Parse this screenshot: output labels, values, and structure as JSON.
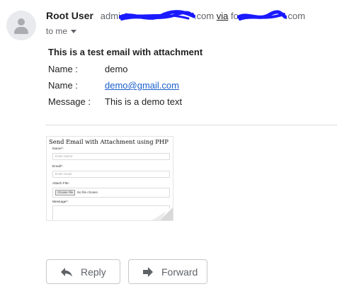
{
  "header": {
    "sender_name": "Root User",
    "sender_addr_start": "admi",
    "sender_addr_end": ".com",
    "via_label": "via",
    "via_addr_start": "fo",
    "via_addr_end": ".com",
    "recipient_label": "to me"
  },
  "message": {
    "title": "This is a test email with attachment",
    "fields": [
      {
        "label": "Name :",
        "value": "demo"
      },
      {
        "label": "Name :",
        "value": "demo@gmail.com"
      },
      {
        "label": "Message :",
        "value": "This is a demo text"
      }
    ]
  },
  "attachment_preview": {
    "title": "Send Email with Attachment using PHP",
    "name_label": "Name*:",
    "name_placeholder": "Enter Name",
    "email_label": "Email*:",
    "email_placeholder": "Enter email",
    "file_label": "Attach File:",
    "choose_file": "Choose File",
    "no_file": "No file chosen",
    "message_label": "Message*:"
  },
  "actions": {
    "reply": "Reply",
    "forward": "Forward"
  },
  "colors": {
    "redaction": "#1a1aff",
    "link": "#1a5fcc"
  }
}
